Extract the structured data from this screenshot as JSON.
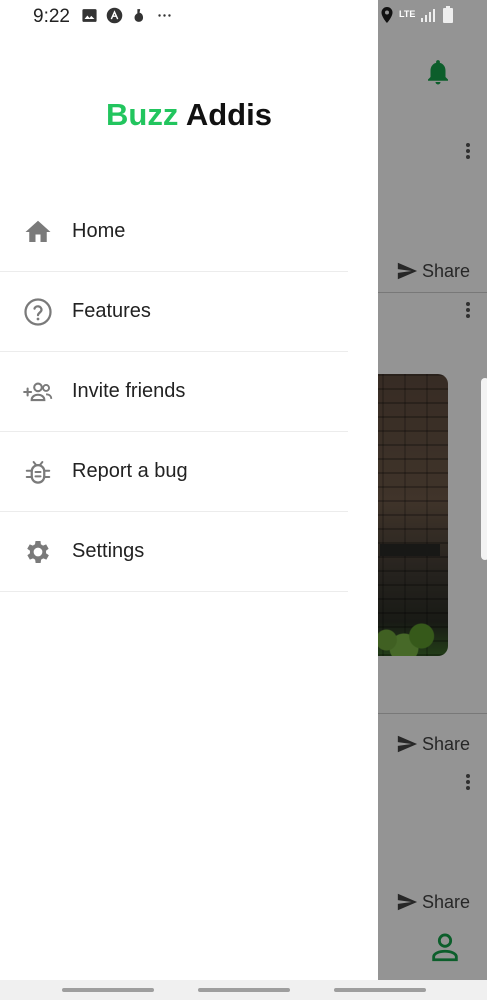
{
  "status_bar": {
    "time": "9:22",
    "left_icons": [
      "image-icon",
      "app-a-icon",
      "drink-icon",
      "more-dots-icon"
    ],
    "right_icons": [
      "location-icon",
      "lte-icon",
      "signal-icon",
      "battery-icon"
    ],
    "network": "LTE"
  },
  "drawer": {
    "title_part1": "Buzz",
    "title_part2": "Addis",
    "brand_color": "#22c55e",
    "items": [
      {
        "label": "Home",
        "icon": "home-icon"
      },
      {
        "label": "Features",
        "icon": "help-circle-icon"
      },
      {
        "label": "Invite friends",
        "icon": "add-people-icon"
      },
      {
        "label": "Report a bug",
        "icon": "bug-icon"
      },
      {
        "label": "Settings",
        "icon": "gear-icon"
      }
    ]
  },
  "background": {
    "share_labels": [
      "Share",
      "Share",
      "Share"
    ],
    "accent_color": "#22c55e"
  }
}
